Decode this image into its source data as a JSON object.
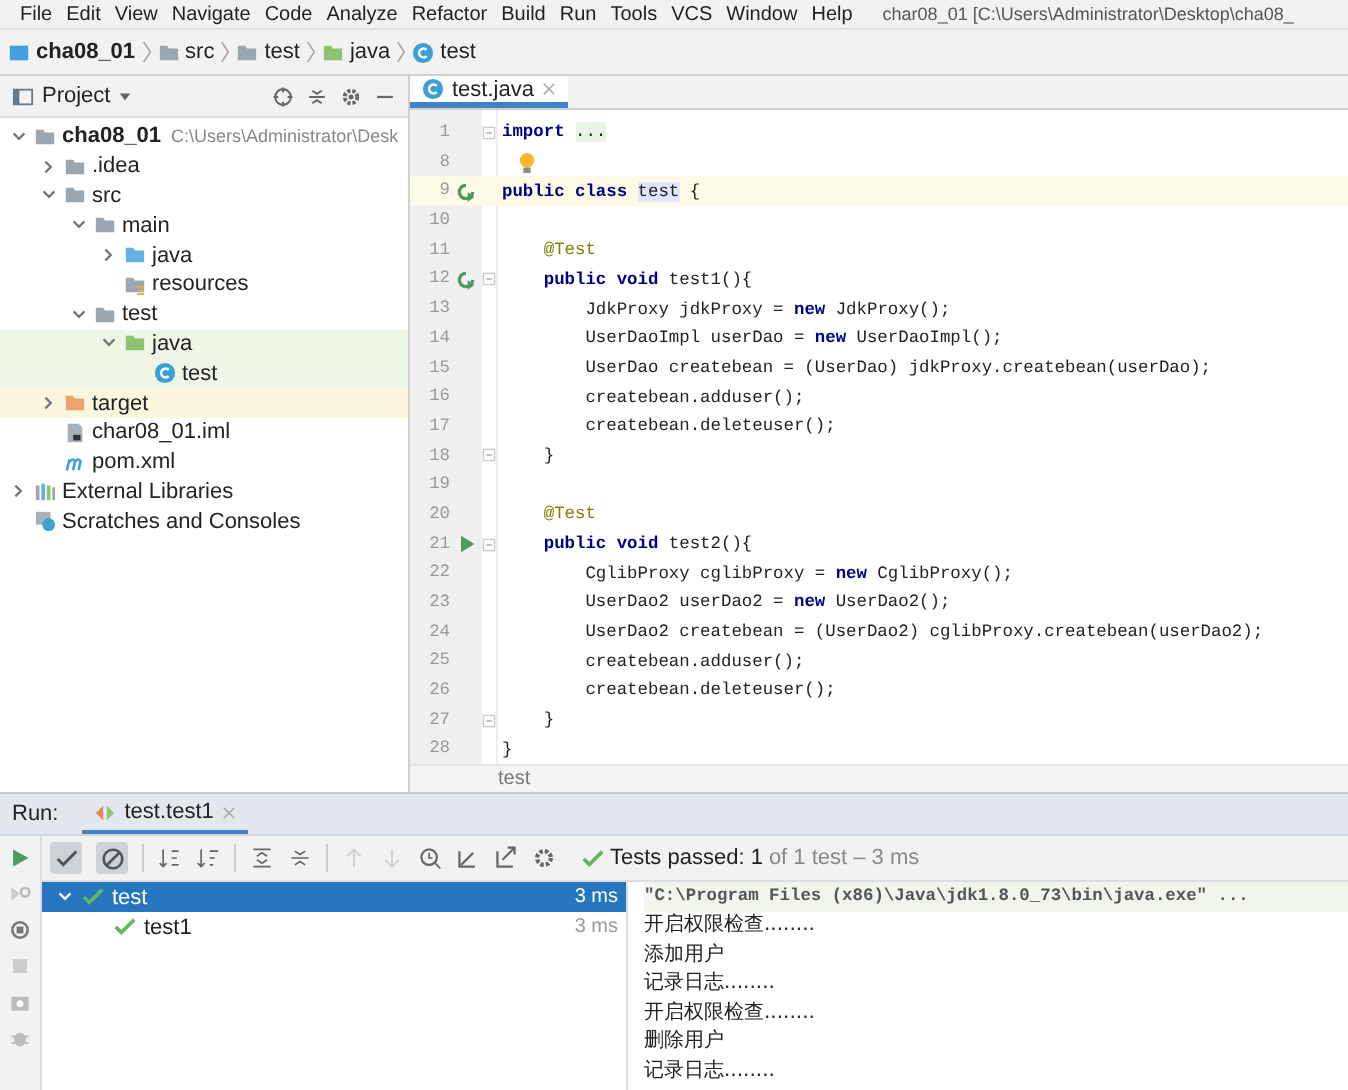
{
  "menu": [
    "File",
    "Edit",
    "View",
    "Navigate",
    "Code",
    "Analyze",
    "Refactor",
    "Build",
    "Run",
    "Tools",
    "VCS",
    "Window",
    "Help"
  ],
  "window_title": "char08_01 [C:\\Users\\Administrator\\Desktop\\cha08_",
  "breadcrumbs": [
    {
      "label": "cha08_01",
      "kind": "module"
    },
    {
      "label": "src",
      "kind": "folder"
    },
    {
      "label": "test",
      "kind": "folder"
    },
    {
      "label": "java",
      "kind": "test-root"
    },
    {
      "label": "test",
      "kind": "class"
    }
  ],
  "project_panel": {
    "title": "Project",
    "tree": [
      {
        "label": "cha08_01",
        "path": "C:\\Users\\Administrator\\Desk",
        "kind": "module",
        "expanded": true,
        "children": [
          {
            "label": ".idea",
            "kind": "folder",
            "expanded": false
          },
          {
            "label": "src",
            "kind": "folder",
            "expanded": true,
            "children": [
              {
                "label": "main",
                "kind": "folder",
                "expanded": true,
                "children": [
                  {
                    "label": "java",
                    "kind": "source-root",
                    "expanded": false
                  },
                  {
                    "label": "resources",
                    "kind": "resources"
                  }
                ]
              },
              {
                "label": "test",
                "kind": "folder",
                "expanded": true,
                "children": [
                  {
                    "label": "java",
                    "kind": "test-root",
                    "expanded": true,
                    "children": [
                      {
                        "label": "test",
                        "kind": "class"
                      }
                    ]
                  }
                ]
              }
            ]
          },
          {
            "label": "target",
            "kind": "excluded",
            "expanded": false
          },
          {
            "label": "char08_01.iml",
            "kind": "iml"
          },
          {
            "label": "pom.xml",
            "kind": "maven"
          }
        ]
      },
      {
        "label": "External Libraries",
        "kind": "libraries",
        "expanded": false
      },
      {
        "label": "Scratches and Consoles",
        "kind": "scratches"
      }
    ]
  },
  "editor": {
    "tabs": [
      {
        "label": "test.java",
        "selected": true
      }
    ],
    "lines": [
      {
        "no": "1",
        "fold": true,
        "segs": [
          {
            "t": "import ",
            "kind": "kw"
          },
          {
            "t": "...",
            "kind": "folded"
          }
        ]
      },
      {
        "no": "8",
        "gutter": {
          "kind": "bulb"
        }
      },
      {
        "no": "9",
        "gutter": {
          "kind": "rerun"
        },
        "current": true,
        "segs": [
          {
            "t": "public class ",
            "kind": "kw"
          },
          {
            "t": "test",
            "kind": "ref"
          },
          {
            "t": " {",
            "kind": "plain"
          }
        ]
      },
      {
        "no": "10"
      },
      {
        "no": "11",
        "segs": [
          {
            "t": "    @Test",
            "kind": "ann"
          }
        ]
      },
      {
        "no": "12",
        "gutter": {
          "kind": "rerun"
        },
        "fold": true,
        "segs": [
          {
            "t": "    public void",
            "kind": "kw"
          },
          {
            "t": " test1(){",
            "kind": "plain"
          }
        ]
      },
      {
        "no": "13",
        "segs": [
          {
            "t": "        JdkProxy jdkProxy = ",
            "kind": "plain"
          },
          {
            "t": "new",
            "kind": "kw"
          },
          {
            "t": " JdkProxy();",
            "kind": "plain"
          }
        ]
      },
      {
        "no": "14",
        "segs": [
          {
            "t": "        UserDaoImpl userDao = ",
            "kind": "plain"
          },
          {
            "t": "new",
            "kind": "kw"
          },
          {
            "t": " UserDaoImpl();",
            "kind": "plain"
          }
        ]
      },
      {
        "no": "15",
        "segs": [
          {
            "t": "        UserDao createbean = (UserDao) jdkProxy.createbean(userDao);",
            "kind": "plain"
          }
        ]
      },
      {
        "no": "16",
        "segs": [
          {
            "t": "        createbean.adduser();",
            "kind": "plain"
          }
        ]
      },
      {
        "no": "17",
        "segs": [
          {
            "t": "        createbean.deleteuser();",
            "kind": "plain"
          }
        ]
      },
      {
        "no": "18",
        "fold": true,
        "segs": [
          {
            "t": "    }",
            "kind": "plain"
          }
        ]
      },
      {
        "no": "19"
      },
      {
        "no": "20",
        "segs": [
          {
            "t": "    @Test",
            "kind": "ann"
          }
        ]
      },
      {
        "no": "21",
        "gutter": {
          "kind": "run"
        },
        "fold": true,
        "segs": [
          {
            "t": "    public void",
            "kind": "kw"
          },
          {
            "t": " test2(){",
            "kind": "plain"
          }
        ]
      },
      {
        "no": "22",
        "segs": [
          {
            "t": "        CglibProxy cglibProxy = ",
            "kind": "plain"
          },
          {
            "t": "new",
            "kind": "kw"
          },
          {
            "t": " CglibProxy();",
            "kind": "plain"
          }
        ]
      },
      {
        "no": "23",
        "segs": [
          {
            "t": "        UserDao2 userDao2 = ",
            "kind": "plain"
          },
          {
            "t": "new",
            "kind": "kw"
          },
          {
            "t": " UserDao2();",
            "kind": "plain"
          }
        ]
      },
      {
        "no": "24",
        "segs": [
          {
            "t": "        UserDao2 createbean = (UserDao2) cglibProxy.createbean(userDao2);",
            "kind": "plain"
          }
        ]
      },
      {
        "no": "25",
        "segs": [
          {
            "t": "        createbean.adduser();",
            "kind": "plain"
          }
        ]
      },
      {
        "no": "26",
        "segs": [
          {
            "t": "        createbean.deleteuser();",
            "kind": "plain"
          }
        ]
      },
      {
        "no": "27",
        "fold": true,
        "segs": [
          {
            "t": "    }",
            "kind": "plain"
          }
        ]
      },
      {
        "no": "28",
        "segs": [
          {
            "t": "}",
            "kind": "plain"
          }
        ]
      }
    ],
    "breadcrumb": "test"
  },
  "run_panel": {
    "label": "Run:",
    "tabs": [
      {
        "label": "test.test1",
        "selected": true
      }
    ],
    "toggles": [
      {
        "kind": "passed",
        "on": true
      },
      {
        "kind": "ignored",
        "on": true
      }
    ],
    "status": "Tests passed: 1",
    "status_detail": "of 1 test – 3 ms",
    "tests": [
      {
        "label": "test",
        "time": "3 ms",
        "selected": true,
        "expanded": true,
        "children": [
          {
            "label": "test1",
            "time": "3 ms",
            "selected": false
          }
        ]
      }
    ],
    "command": "\"C:\\Program Files (x86)\\Java\\jdk1.8.0_73\\bin\\java.exe\" ...",
    "output": [
      "开启权限检查........",
      "添加用户",
      "记录日志........",
      "开启权限检查........",
      "删除用户",
      "记录日志........"
    ]
  }
}
